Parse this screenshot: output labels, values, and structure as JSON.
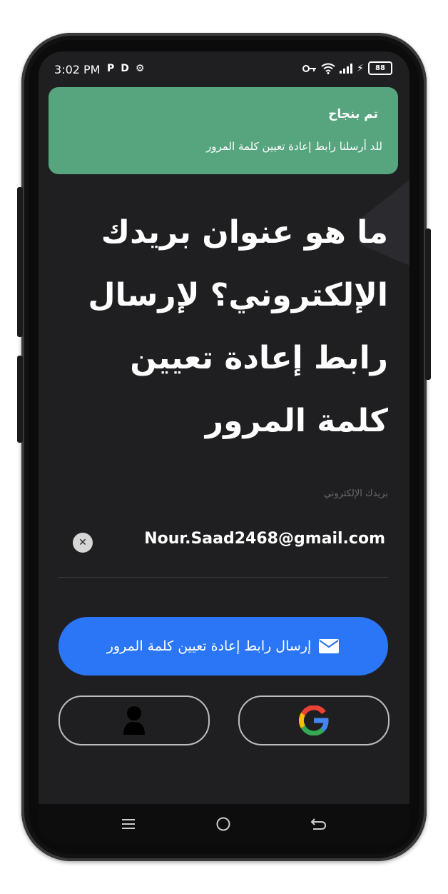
{
  "status_bar": {
    "time": "3:02 PM",
    "app_icons": [
      "P",
      "D"
    ],
    "battery": "88"
  },
  "toast": {
    "title": "تم بنجاح",
    "message": "للد أرسلنا رابط إعادة تعيين كلمة المرور",
    "color": "#56a57f"
  },
  "main": {
    "headline": "ما هو عنوان بريدك الإلكتروني؟ لإرسال رابط إعادة تعيين كلمة المرور",
    "email_label": "بريدك الإلكتروني",
    "email_value": "Nour.Saad2468@gmail.com",
    "clear_icon": "close-icon"
  },
  "actions": {
    "send_label": "إرسال رابط إعادة تعيين كلمة المرور",
    "send_icon": "mail-icon",
    "google_icon": "google-icon",
    "guest_icon": "person-icon",
    "accent": "#2a76f6"
  },
  "nav": {
    "icons": [
      "menu-icon",
      "home-icon",
      "back-icon"
    ]
  }
}
